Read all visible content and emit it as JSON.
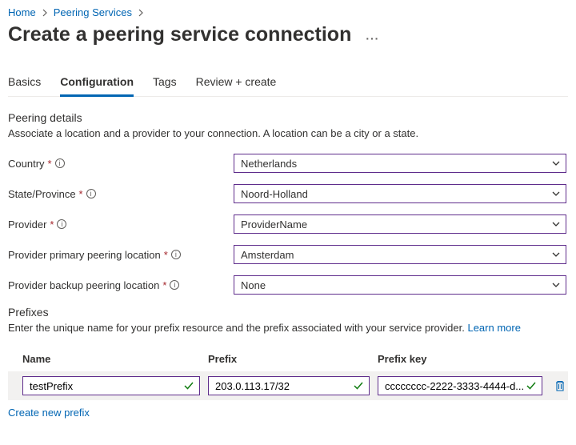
{
  "breadcrumb": {
    "home": "Home",
    "peering": "Peering Services"
  },
  "page": {
    "title": "Create a peering service connection"
  },
  "tabs": {
    "basics": "Basics",
    "configuration": "Configuration",
    "tags": "Tags",
    "review": "Review + create"
  },
  "details": {
    "heading": "Peering details",
    "desc": "Associate a location and a provider to your connection. A location can be a city or a state."
  },
  "labels": {
    "country": "Country",
    "state": "State/Province",
    "provider": "Provider",
    "primary": "Provider primary peering location",
    "backup": "Provider backup peering location"
  },
  "values": {
    "country": "Netherlands",
    "state": "Noord-Holland",
    "provider": "ProviderName",
    "primary": "Amsterdam",
    "backup": "None"
  },
  "prefixes": {
    "heading": "Prefixes",
    "desc": "Enter the unique name for your prefix resource and the prefix associated with your service provider. ",
    "learn": "Learn more",
    "col_name": "Name",
    "col_prefix": "Prefix",
    "col_key": "Prefix key",
    "row": {
      "name": "testPrefix",
      "prefix": "203.0.113.17/32",
      "key": "cccccccc-2222-3333-4444-d..."
    },
    "create": "Create new prefix"
  }
}
